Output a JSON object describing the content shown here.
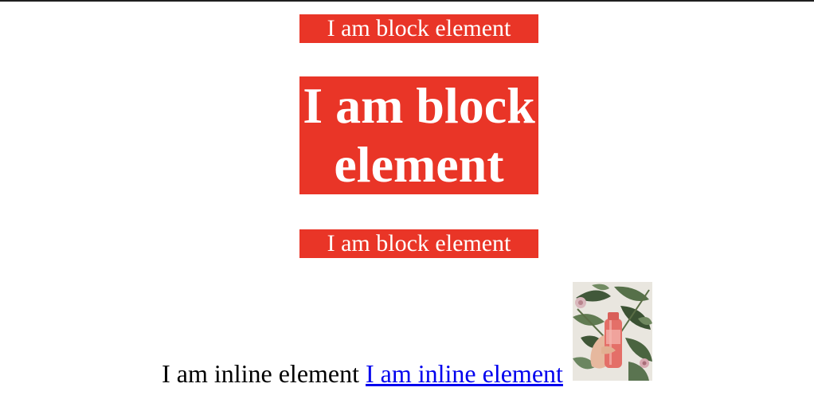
{
  "blocks": [
    {
      "text": "I am block element"
    },
    {
      "text": "I am block element"
    },
    {
      "text": "I am block element"
    }
  ],
  "inline": {
    "text": "I am inline element",
    "link_text": "I am inline element",
    "image_icon": "photo-bottle-with-leaves"
  },
  "colors": {
    "block_background": "#e93527",
    "block_text": "#ffffff",
    "link": "#0000ee"
  }
}
